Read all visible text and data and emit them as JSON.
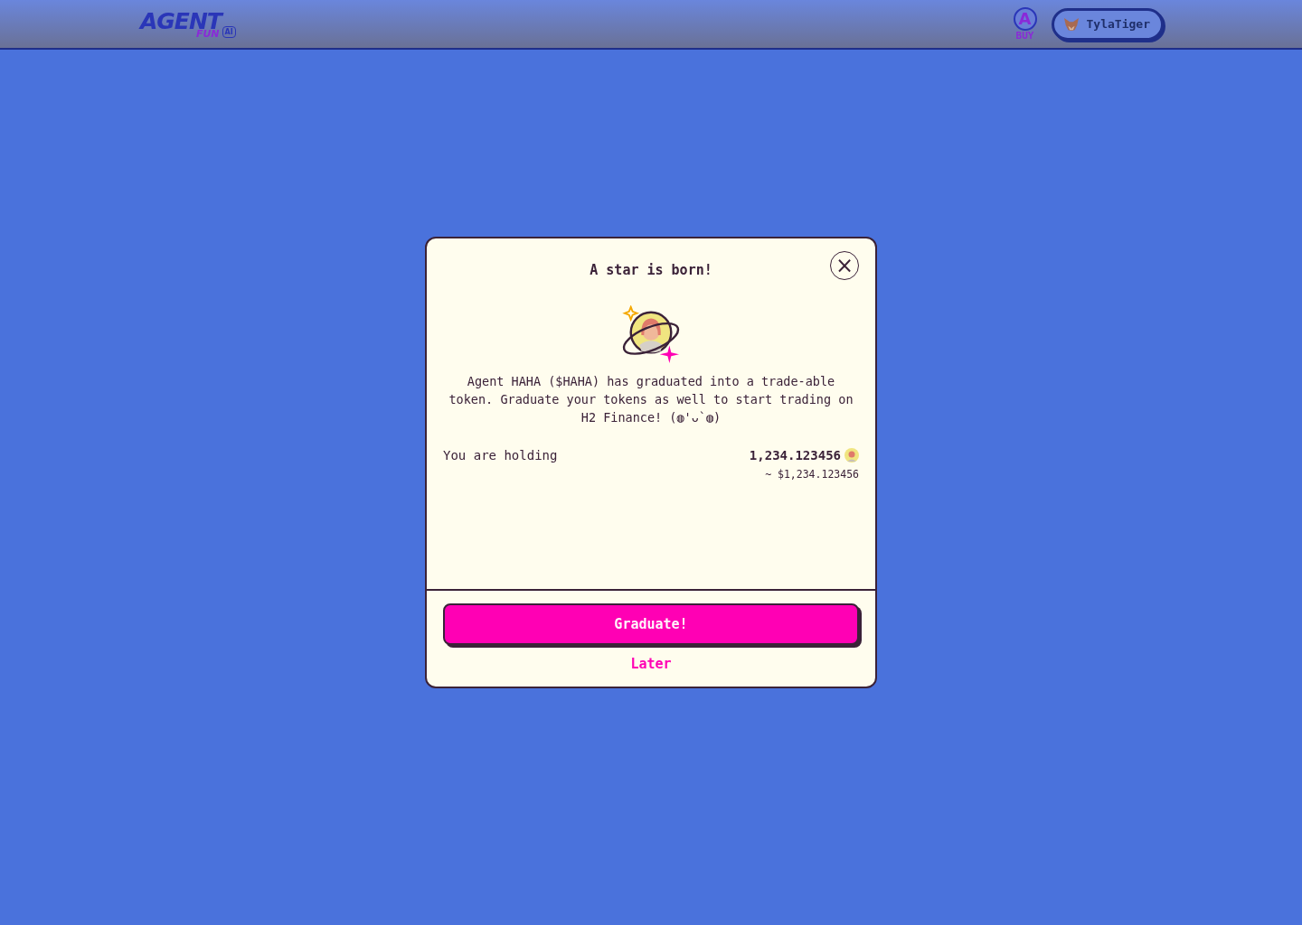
{
  "header": {
    "logo": {
      "word": "AGENT",
      "sub": "FUN",
      "badge": "AI"
    },
    "buy": {
      "letter": "A",
      "label": "BUY"
    },
    "wallet": {
      "name": "TylaTiger"
    }
  },
  "modal": {
    "title": "A star is born!",
    "close": "×",
    "message": "Agent HAHA ($HAHA) has graduated into a trade-able token. Graduate your tokens as well to start trading on H2 Finance! (◍'ᴗ`◍)",
    "holding": {
      "label": "You are holding",
      "amount": "1,234.123456",
      "usd": "~ $1,234.123456"
    },
    "primary": "Graduate!",
    "secondary": "Later"
  }
}
